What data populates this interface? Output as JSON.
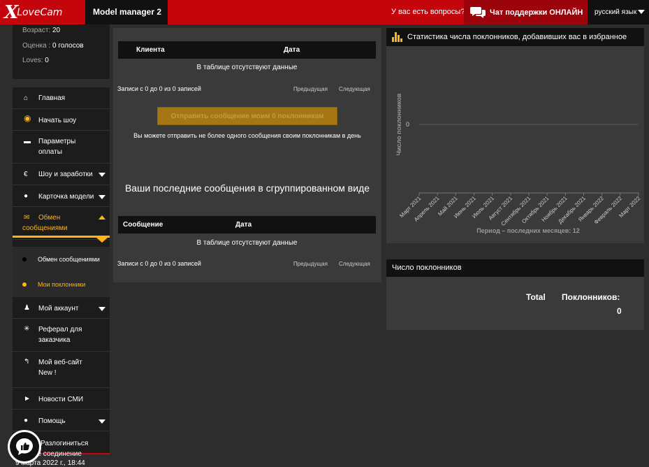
{
  "header": {
    "logo": {
      "x": "X",
      "rest": "LoveCam"
    },
    "model_manager": "Model manager 2",
    "question": "У вас есть вопросы?",
    "support": "Чат поддержки ОНЛАЙН",
    "language": "русский язык"
  },
  "profile": {
    "age_label": "Возраст:",
    "age_value": "20",
    "rating_label": "Оценка :",
    "rating_value": "0 голосов",
    "loves_label": "Loves:",
    "loves_value": "0"
  },
  "nav": {
    "home": "Главная",
    "start_show": "Начать шоу",
    "payment": "Параметры оплаты",
    "shows": "Шоу и заработки",
    "card": "Карточка модели",
    "messages": "Обмен сообщениями",
    "sub_messages": "Обмен сообщениями",
    "sub_fans": "Мои поклонники",
    "account": "Мой аккаунт",
    "referral": "Реферал для заказчика",
    "website": "Мой веб-сайт New !",
    "news": "Новости СМИ",
    "help": "Помощь",
    "logout": "Разлогиниться"
  },
  "last_connection": {
    "label": "...нее соединение",
    "value": "9 марта 2022 г., 18:44"
  },
  "fans_table": {
    "col_client": "Клиента",
    "col_date": "Дата",
    "empty": "В таблице отсутствуют данные",
    "info": "Записи с 0 до 0 из 0 записей",
    "prev": "Предыдущая",
    "next": "Следующая"
  },
  "send_button": "Отправить сообщение моим 0 поклонникам",
  "send_note": "Вы можете отправить не более одного сообщения своим поклонникам в день",
  "grouped_title": "Ваши последние сообщения в сгруппированном виде",
  "messages_table": {
    "col_message": "Сообщение",
    "col_date": "Дата",
    "empty": "В таблице отсутствуют данные",
    "info": "Записи с 0 до 0 из 0 записей",
    "prev": "Предыдущая",
    "next": "Следующая"
  },
  "stats_title": "Статистика числа поклонников, добавивших вас в избранное",
  "chart_data": {
    "type": "line",
    "title": "",
    "ylabel": "Число поклонников",
    "xlabel": "Период – последних месяцев: 12",
    "categories": [
      "Март 2021",
      "Апрель 2021",
      "Май 2021",
      "Июнь 2021",
      "Июль 2021",
      "Август 2021",
      "Сентябрь 2021",
      "Октябрь 2021",
      "Ноябрь 2021",
      "Декабрь 2021",
      "Январь 2022",
      "Февраль 2022",
      "Март 2022"
    ],
    "y_ticks": [
      "0"
    ],
    "series": [
      {
        "values": [
          0,
          0,
          0,
          0,
          0,
          0,
          0,
          0,
          0,
          0,
          0,
          0,
          0
        ]
      }
    ]
  },
  "fans_count": {
    "title": "Число поклонников",
    "total_label": "Total",
    "fans_label": "Поклонников:",
    "value": "0"
  },
  "colors": {
    "brand_red": "#c5050c",
    "accent": "#ffb414"
  }
}
